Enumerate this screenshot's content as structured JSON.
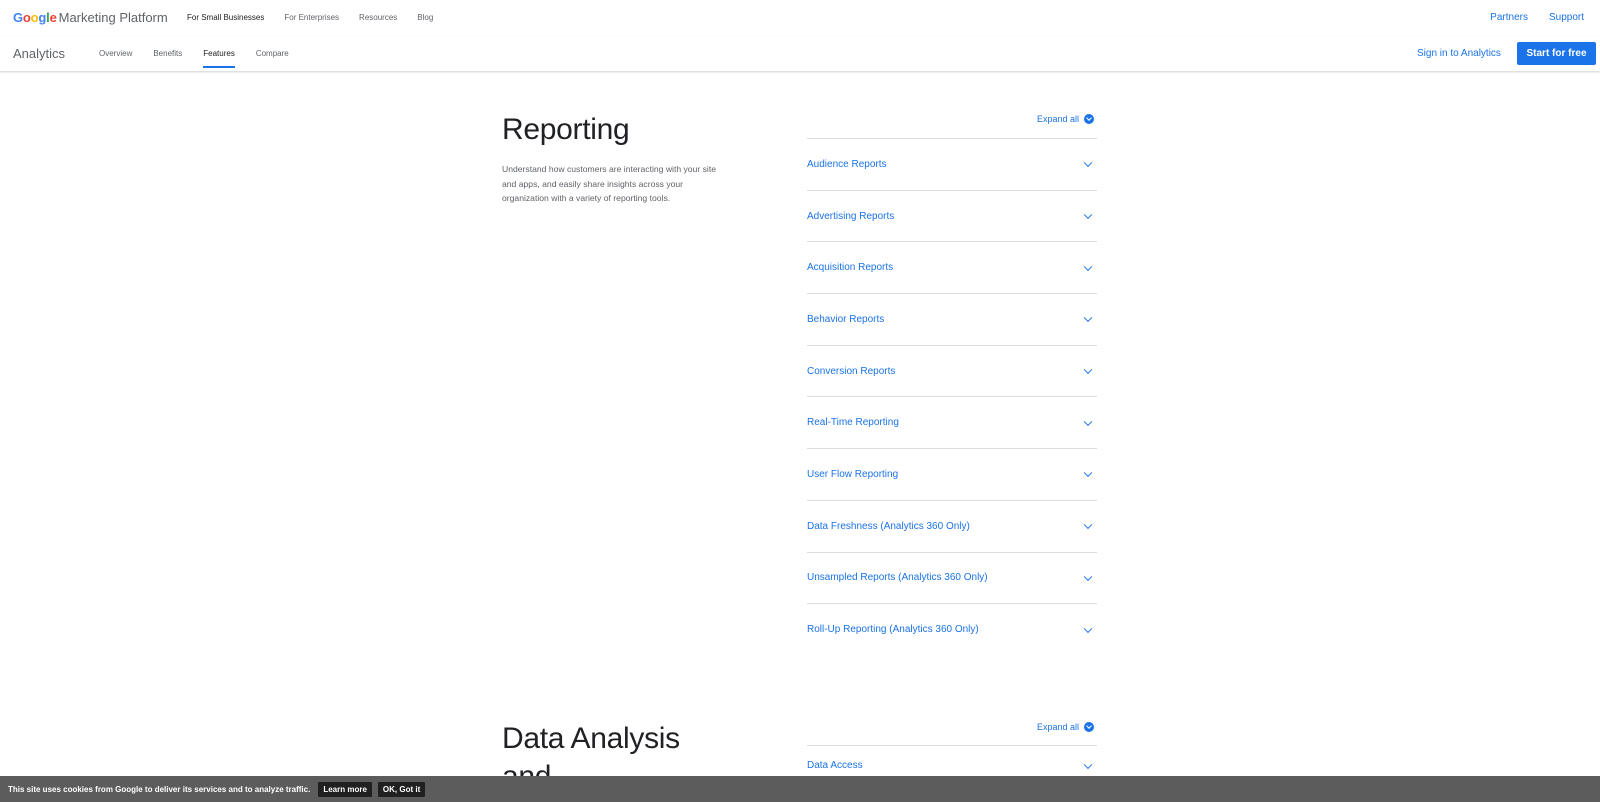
{
  "header": {
    "brand_google": "Google",
    "brand_rest": "Marketing Platform",
    "nav": [
      "For Small Businesses",
      "For Enterprises",
      "Resources",
      "Blog"
    ],
    "right_links": [
      "Partners",
      "Support"
    ]
  },
  "subheader": {
    "product": "Analytics",
    "tabs": [
      "Overview",
      "Benefits",
      "Features",
      "Compare"
    ],
    "active_tab": "Features",
    "sign_in": "Sign in to Analytics",
    "cta": "Start for free"
  },
  "reporting": {
    "title": "Reporting",
    "description": "Understand how customers are interacting with your site and apps, and easily share insights across your organization with a variety of reporting tools.",
    "expand_all": "Expand all",
    "items": [
      "Audience Reports",
      "Advertising Reports",
      "Acquisition Reports",
      "Behavior Reports",
      "Conversion Reports",
      "Real-Time Reporting",
      "User Flow Reporting",
      "Data Freshness (Analytics 360 Only)",
      "Unsampled Reports (Analytics 360 Only)",
      "Roll-Up Reporting (Analytics 360 Only)"
    ]
  },
  "data_analysis": {
    "title_line1": "Data Analysis",
    "title_line2": "and",
    "expand_all": "Expand all",
    "items": [
      "Data Access"
    ]
  },
  "cookie_bar": {
    "message": "This site uses cookies from Google to deliver its services and to analyze traffic.",
    "learn_more": "Learn more",
    "ok": "OK, Got it"
  },
  "colors": {
    "accent": "#1a73e8",
    "google_blue": "#4285f4",
    "google_red": "#ea4335",
    "google_yellow": "#fbbc05",
    "google_green": "#34a853"
  }
}
